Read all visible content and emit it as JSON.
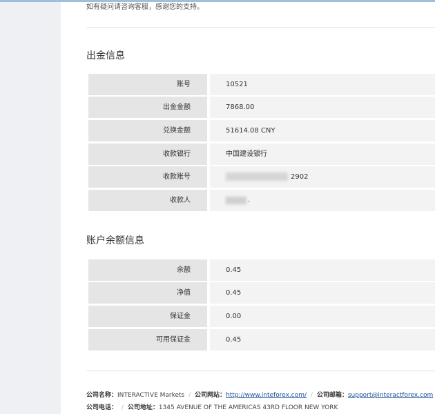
{
  "notice": "如有疑问请咨询客服，感谢您的支持。",
  "withdrawal": {
    "title": "出金信息",
    "rows": [
      {
        "label": "账号",
        "value": "10521"
      },
      {
        "label": "出金金额",
        "value": "7868.00"
      },
      {
        "label": "兑换金额",
        "value": "51614.08 CNY"
      },
      {
        "label": "收款银行",
        "value": "中国建设银行"
      },
      {
        "label": "收款账号",
        "value": "2902"
      },
      {
        "label": "收款人",
        "value": "."
      }
    ]
  },
  "balance": {
    "title": "账户余额信息",
    "rows": [
      {
        "label": "余额",
        "value": "0.45"
      },
      {
        "label": "净值",
        "value": "0.45"
      },
      {
        "label": "保证金",
        "value": "0.00"
      },
      {
        "label": "可用保证金",
        "value": "0.45"
      }
    ]
  },
  "footer": {
    "company_name_label": "公司名称：",
    "company_name": "INTERACTIVE Markets",
    "website_label": "公司网站：",
    "website": "http://www.inteforex.com/",
    "email_label": "公司邮箱：",
    "email": "support@interactforex.com",
    "phone_label": "公司电话：",
    "address_label": "公司地址：",
    "address": "1345 AVENUE OF THE AMERICAS 43RD FLOOR NEW YORK",
    "separator": "/"
  }
}
